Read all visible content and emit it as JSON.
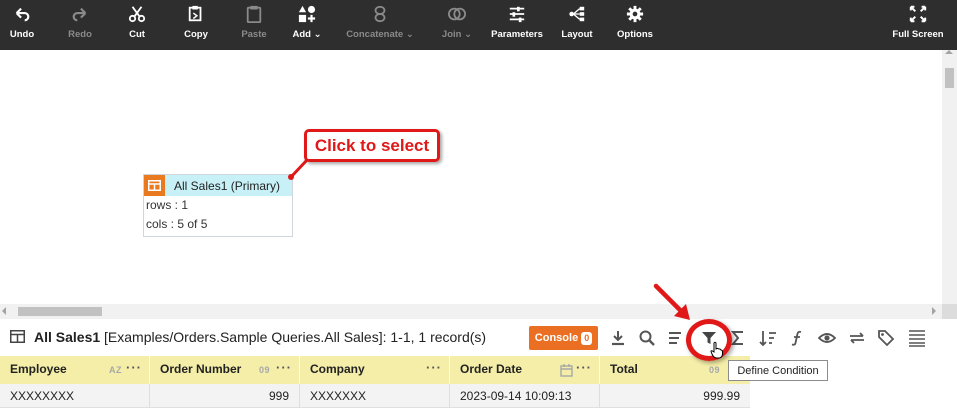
{
  "toolbar": {
    "undo": "Undo",
    "redo": "Redo",
    "cut": "Cut",
    "copy": "Copy",
    "paste": "Paste",
    "add": "Add",
    "concatenate": "Concatenate",
    "join": "Join",
    "parameters": "Parameters",
    "layout": "Layout",
    "options": "Options",
    "full_screen": "Full Screen"
  },
  "node": {
    "title": "All Sales1 (Primary)",
    "rows": "rows : 1",
    "cols": "cols : 5 of 5"
  },
  "callout": "Click to select",
  "panel": {
    "name": "All Sales1",
    "path": "[Examples/Orders.Sample Queries.All Sales]: 1-1, 1 record(s)",
    "console_label": "Console",
    "console_count": "0"
  },
  "table": {
    "columns": [
      {
        "name": "Employee",
        "type_tag": "AZ"
      },
      {
        "name": "Order Number",
        "type_tag": "09"
      },
      {
        "name": "Company",
        "type_tag": ""
      },
      {
        "name": "Order Date",
        "type_tag": ""
      },
      {
        "name": "Total",
        "type_tag": "09"
      }
    ],
    "row": [
      "XXXXXXXX",
      "999",
      "XXXXXXX",
      "2023-09-14 10:09:13",
      "999.99"
    ]
  },
  "tooltip": "Define Condition",
  "colors": {
    "toolbar_bg": "#2e2e2e",
    "accent_orange": "#ea7a1f",
    "node_header": "#c8f1f7",
    "annotation_red": "#e01818",
    "header_yellow": "#f4eea8"
  },
  "icons": [
    "undo-icon",
    "redo-icon",
    "scissors-icon",
    "copy-icon",
    "paste-icon",
    "add-shapes-icon",
    "concatenate-icon",
    "join-icon",
    "sliders-icon",
    "layout-tree-icon",
    "gear-icon",
    "expand-icon",
    "table-icon",
    "download-icon",
    "search-icon",
    "sort-lines-icon",
    "filter-icon",
    "sigma-icon",
    "sort-arrows-icon",
    "function-icon",
    "eye-icon",
    "swap-icon",
    "tags-icon",
    "columns-icon"
  ]
}
